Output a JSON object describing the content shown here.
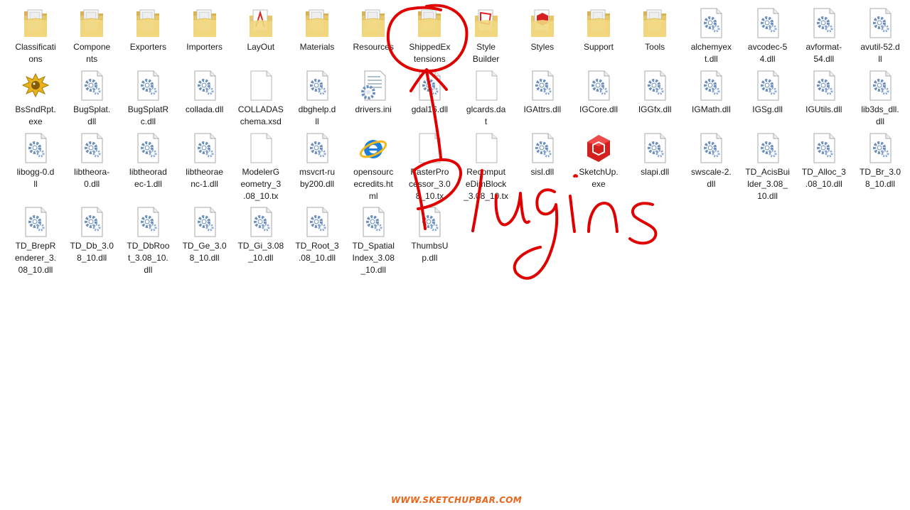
{
  "files": [
    {
      "name": "Classifications",
      "display": "Classificati\nons",
      "icon": "folder-icon"
    },
    {
      "name": "Components",
      "display": "Compone\nnts",
      "icon": "folder-icon"
    },
    {
      "name": "Exporters",
      "display": "Exporters",
      "icon": "folder-icon"
    },
    {
      "name": "Importers",
      "display": "Importers",
      "icon": "folder-icon"
    },
    {
      "name": "LayOut",
      "display": "LayOut",
      "icon": "folder-layout-icon"
    },
    {
      "name": "Materials",
      "display": "Materials",
      "icon": "folder-icon"
    },
    {
      "name": "Resources",
      "display": "Resources",
      "icon": "folder-icon"
    },
    {
      "name": "ShippedExtensions",
      "display": "ShippedEx\ntensions",
      "icon": "folder-icon"
    },
    {
      "name": "Style Builder",
      "display": "Style\nBuilder",
      "icon": "folder-stylebuilder-icon"
    },
    {
      "name": "Styles",
      "display": "Styles",
      "icon": "folder-sketchup-icon"
    },
    {
      "name": "Support",
      "display": "Support",
      "icon": "folder-icon"
    },
    {
      "name": "Tools",
      "display": "Tools",
      "icon": "folder-icon"
    },
    {
      "name": "alchemyext.dll",
      "display": "alchemyex\nt.dll",
      "icon": "dll-gear-icon"
    },
    {
      "name": "avcodec-54.dll",
      "display": "avcodec-5\n4.dll",
      "icon": "dll-gear-icon"
    },
    {
      "name": "avformat-54.dll",
      "display": "avformat-\n54.dll",
      "icon": "dll-gear-icon"
    },
    {
      "name": "avutil-52.dll",
      "display": "avutil-52.d\nll",
      "icon": "dll-gear-icon"
    },
    {
      "name": "BsSndRpt.exe",
      "display": "BsSndRpt.\nexe",
      "icon": "bugsplat-icon"
    },
    {
      "name": "BugSplat.dll",
      "display": "BugSplat.\ndll",
      "icon": "dll-gear-icon"
    },
    {
      "name": "BugSplatRc.dll",
      "display": "BugSplatR\nc.dll",
      "icon": "dll-gear-icon"
    },
    {
      "name": "collada.dll",
      "display": "collada.dll",
      "icon": "dll-gear-icon"
    },
    {
      "name": "COLLADASchema.xsd",
      "display": "COLLADAS\nchema.xsd",
      "icon": "blank-file-icon"
    },
    {
      "name": "dbghelp.dll",
      "display": "dbghelp.d\nll",
      "icon": "dll-gear-icon"
    },
    {
      "name": "drivers.ini",
      "display": "drivers.ini",
      "icon": "ini-file-icon"
    },
    {
      "name": "gdal16.dll",
      "display": "gdal16.dll",
      "icon": "dll-gear-icon"
    },
    {
      "name": "glcards.dat",
      "display": "glcards.da\nt",
      "icon": "blank-file-icon"
    },
    {
      "name": "IGAttrs.dll",
      "display": "IGAttrs.dll",
      "icon": "dll-gear-icon"
    },
    {
      "name": "IGCore.dll",
      "display": "IGCore.dll",
      "icon": "dll-gear-icon"
    },
    {
      "name": "IGGfx.dll",
      "display": "IGGfx.dll",
      "icon": "dll-gear-icon"
    },
    {
      "name": "IGMath.dll",
      "display": "IGMath.dll",
      "icon": "dll-gear-icon"
    },
    {
      "name": "IGSg.dll",
      "display": "IGSg.dll",
      "icon": "dll-gear-icon"
    },
    {
      "name": "IGUtils.dll",
      "display": "IGUtils.dll",
      "icon": "dll-gear-icon"
    },
    {
      "name": "lib3ds_dll.dll",
      "display": "lib3ds_dll.\ndll",
      "icon": "dll-gear-icon"
    },
    {
      "name": "libogg-0.dll",
      "display": "libogg-0.d\nll",
      "icon": "dll-gear-icon"
    },
    {
      "name": "libtheora-0.dll",
      "display": "libtheora-\n0.dll",
      "icon": "dll-gear-icon"
    },
    {
      "name": "libtheoradec-1.dll",
      "display": "libtheorad\nec-1.dll",
      "icon": "dll-gear-icon"
    },
    {
      "name": "libtheoraenc-1.dll",
      "display": "libtheorae\nnc-1.dll",
      "icon": "dll-gear-icon"
    },
    {
      "name": "ModelerGeometry_3.08_10.tx",
      "display": "ModelerG\neometry_3\n.08_10.tx",
      "icon": "blank-file-icon"
    },
    {
      "name": "msvcrt-ruby200.dll",
      "display": "msvcrt-ru\nby200.dll",
      "icon": "dll-gear-icon"
    },
    {
      "name": "opensourcecredits.html",
      "display": "opensourc\necredits.ht\nml",
      "icon": "internet-explorer-icon"
    },
    {
      "name": "RasterProcessor_3.08_10.tx",
      "display": "RasterPro\ncessor_3.0\n8_10.tx",
      "icon": "blank-file-icon"
    },
    {
      "name": "RecomputeDimBlock_3.08_10.tx",
      "display": "Recomput\neDimBlock\n_3.08_10.tx",
      "icon": "blank-file-icon"
    },
    {
      "name": "sisl.dll",
      "display": "sisl.dll",
      "icon": "dll-gear-icon"
    },
    {
      "name": "SketchUp.exe",
      "display": "SketchUp.\nexe",
      "icon": "sketchup-icon"
    },
    {
      "name": "slapi.dll",
      "display": "slapi.dll",
      "icon": "dll-gear-icon"
    },
    {
      "name": "swscale-2.dll",
      "display": "swscale-2.\ndll",
      "icon": "dll-gear-icon"
    },
    {
      "name": "TD_AcisBuilder_3.08_10.dll",
      "display": "TD_AcisBui\nlder_3.08_\n10.dll",
      "icon": "dll-gear-icon"
    },
    {
      "name": "TD_Alloc_3.08_10.dll",
      "display": "TD_Alloc_3\n.08_10.dll",
      "icon": "dll-gear-icon"
    },
    {
      "name": "TD_Br_3.08_10.dll",
      "display": "TD_Br_3.0\n8_10.dll",
      "icon": "dll-gear-icon"
    },
    {
      "name": "TD_BrepRenderer_3.08_10.dll",
      "display": "TD_BrepR\nenderer_3.\n08_10.dll",
      "icon": "dll-gear-icon"
    },
    {
      "name": "TD_Db_3.08_10.dll",
      "display": "TD_Db_3.0\n8_10.dll",
      "icon": "dll-gear-icon"
    },
    {
      "name": "TD_DbRoot_3.08_10.dll",
      "display": "TD_DbRoo\nt_3.08_10.\ndll",
      "icon": "dll-gear-icon"
    },
    {
      "name": "TD_Ge_3.08_10.dll",
      "display": "TD_Ge_3.0\n8_10.dll",
      "icon": "dll-gear-icon"
    },
    {
      "name": "TD_Gi_3.08_10.dll",
      "display": "TD_Gi_3.08\n_10.dll",
      "icon": "dll-gear-icon"
    },
    {
      "name": "TD_Root_3.08_10.dll",
      "display": "TD_Root_3\n.08_10.dll",
      "icon": "dll-gear-icon"
    },
    {
      "name": "TD_SpatialIndex_3.08_10.dll",
      "display": "TD_Spatial\nIndex_3.08\n_10.dll",
      "icon": "dll-gear-icon"
    },
    {
      "name": "ThumbsUp.dll",
      "display": "ThumbsU\np.dll",
      "icon": "dll-gear-icon"
    }
  ],
  "annotation": {
    "text": "Plugins",
    "color": "#e00000",
    "highlighted_item": "ShippedExtensions"
  },
  "watermark": {
    "text": "WWW.SKETCHUPBAR.COM",
    "color": "#e8661c"
  }
}
